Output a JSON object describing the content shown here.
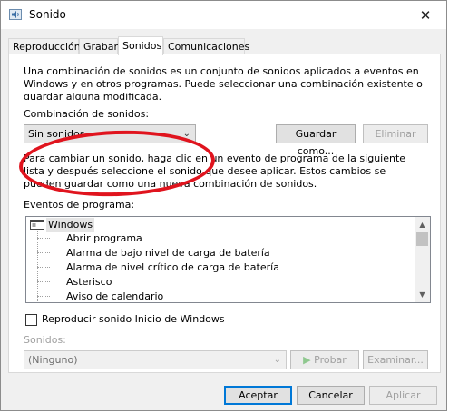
{
  "window": {
    "title": "Sonido",
    "close_symbol": "✕"
  },
  "tabs": [
    {
      "label": "Reproducción",
      "active": false
    },
    {
      "label": "Grabar",
      "active": false
    },
    {
      "label": "Sonidos",
      "active": true
    },
    {
      "label": "Comunicaciones",
      "active": false
    }
  ],
  "scheme": {
    "description": "Una combinación de sonidos es un conjunto de sonidos aplicados a eventos en Windows y en otros programas. Puede seleccionar una combinación existente o guardar alguna modificada.",
    "label": "Combinación de sonidos:",
    "selected": "Sin sonidos",
    "save_button": "Guardar como...",
    "delete_button": "Eliminar"
  },
  "events": {
    "description": "Para cambiar un sonido, haga clic en un evento de programa de la siguiente lista y después seleccione el sonido que desee aplicar. Estos cambios se pueden guardar como una nueva combinación de sonidos.",
    "label": "Eventos de programa:",
    "group": "Windows",
    "items": [
      "Abrir programa",
      "Alarma de bajo nivel de carga de batería",
      "Alarma de nivel crítico de carga de batería",
      "Asterisco",
      "Aviso de calendario"
    ]
  },
  "startup_checkbox": {
    "label": "Reproducir sonido Inicio de Windows",
    "checked": false
  },
  "sounds": {
    "label": "Sonidos:",
    "selected": "(Ninguno)",
    "test_button": "Probar",
    "browse_button": "Examinar..."
  },
  "footer": {
    "accept": "Aceptar",
    "cancel": "Cancelar",
    "apply": "Aplicar"
  },
  "colors": {
    "highlight_oval": "#e0141e",
    "accent": "#0078d7"
  }
}
